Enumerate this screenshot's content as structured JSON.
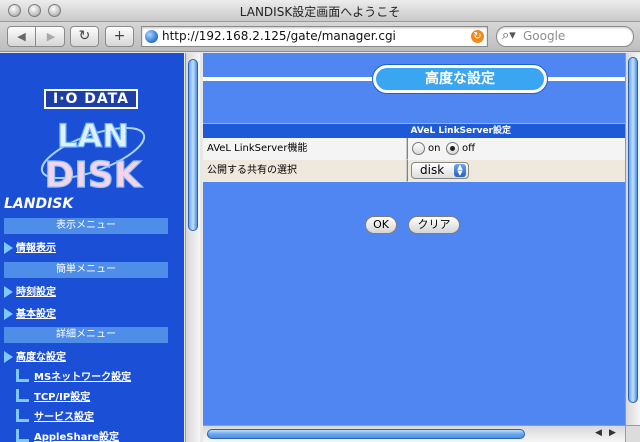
{
  "window": {
    "title": "LANDISK設定画面へようこそ"
  },
  "toolbar": {
    "back_icon": "back-arrow-icon",
    "forward_icon": "forward-arrow-icon",
    "reload_label": "↻",
    "add_label": "+",
    "url": "http://192.168.2.125/gate/manager.cgi",
    "search_placeholder": "Google"
  },
  "sidebar": {
    "logo_top": "I·O DATA",
    "logo_main_line1": "LAN",
    "logo_main_line2": "DISK",
    "brand": "LANDISK",
    "sections": [
      {
        "header": "表示メニュー"
      },
      {
        "header": "簡単メニュー"
      },
      {
        "header": "詳細メニュー"
      }
    ],
    "items": [
      {
        "label": "情報表示"
      },
      {
        "label": "時刻設定"
      },
      {
        "label": "基本設定"
      },
      {
        "label": "高度な設定"
      }
    ],
    "subitems": [
      {
        "label": "MSネットワーク設定"
      },
      {
        "label": "TCP/IP設定"
      },
      {
        "label": "サービス設定"
      },
      {
        "label": "AppleShare設定"
      }
    ]
  },
  "main": {
    "page_title": "高度な設定",
    "table_header": "AVeL LinkServer設定",
    "rows": [
      {
        "label": "AVeL LinkServer機能",
        "option_on": "on",
        "option_off": "off",
        "selected": "off"
      },
      {
        "label": "公開する共有の選択",
        "select_value": "disk"
      }
    ],
    "ok_label": "OK",
    "clear_label": "クリア"
  },
  "colors": {
    "sidebar_bg": "#1a4fd6",
    "main_bg": "#4f86f2",
    "header_blue": "#1e5ad8",
    "pill_blue": "#3aa5f0"
  }
}
